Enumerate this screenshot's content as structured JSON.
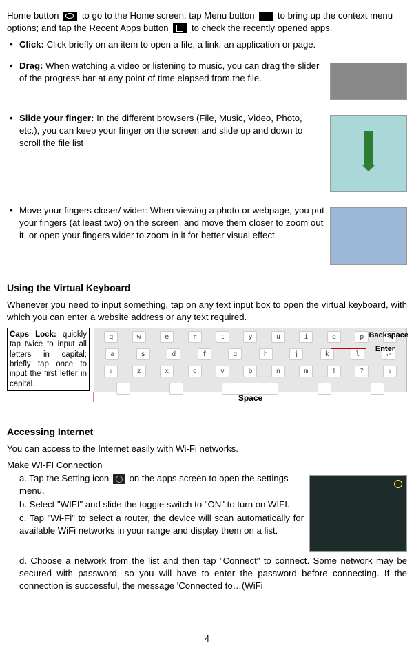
{
  "intro": {
    "seg1": "Home   button",
    "seg2": " to go to the Home screen; tap Menu button",
    "seg3": " to bring up the context menu options; and tap the Recent Apps button",
    "seg4": " to check the recently opened apps."
  },
  "tips": {
    "click": {
      "label": "Click:",
      "text": " Click briefly on an item to open a file, a link, an application or page."
    },
    "drag": {
      "label": "Drag:",
      "text": " When watching a video or listening to music, you can drag the slider of the progress bar at any point of time elapsed from the file."
    },
    "slide": {
      "label": "Slide your finger:",
      "text": " In the different browsers (File, Music, Video, Photo, etc.), you can keep your finger on the screen and slide up and down to scroll the file list"
    },
    "pinch": {
      "text": "Move your fingers closer/ wider: When viewing a photo or webpage, you put your fingers (at least two) on the screen, and move them closer to zoom out it, or open your fingers wider to zoom in it for better visual effect."
    }
  },
  "vk": {
    "heading": "Using the Virtual Keyboard",
    "para": "Whenever you need to input something, tap on any text input box to open the virtual keyboard, with which you can enter a website address or any text required.",
    "caps": {
      "label": "Caps Lock:",
      "text": " quickly tap twice to input all letters in capital; briefly tap once to input the first letter in capital."
    },
    "labels": {
      "backspace": "Backspace",
      "enter": "Enter",
      "space": "Space"
    }
  },
  "net": {
    "heading": "Accessing Internet",
    "para": "You can access to the Internet easily with Wi-Fi networks.",
    "sub": "Make WI-FI Connection",
    "a1": "a. Tap the Setting icon ",
    "a2": " on the apps screen to open the settings menu.",
    "b": "b. Select \"WIFI\" and slide the toggle switch to \"ON\" to turn on WIFI.",
    "c": "c. Tap \"Wi-Fi\" to select a router, the device will scan automatically for available WiFi networks in your range and display them on a list.",
    "d": "d. Choose a network from the list and then tap \"Connect\" to connect. Some network may be secured with password, so you will have to enter the password before connecting. If the connection is successful, the message 'Connected to…(WiFi"
  },
  "page": "4"
}
